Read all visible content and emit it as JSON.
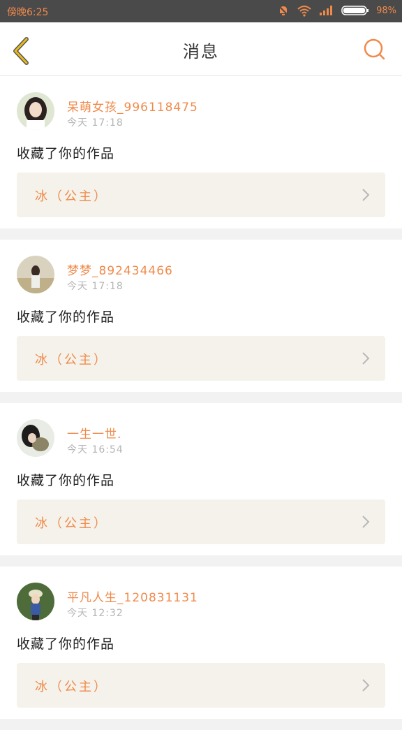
{
  "status_bar": {
    "time": "傍晚6:25",
    "battery": "98%",
    "icons": [
      "bell-off-icon",
      "wifi-icon",
      "signal-icon",
      "battery-icon"
    ]
  },
  "header": {
    "title": "消息",
    "back_icon": "chevron-left-icon",
    "search_icon": "search-icon"
  },
  "colors": {
    "accent": "#f08a4b",
    "back_arrow": "#e8b91c",
    "card_bg": "#f4f2ea"
  },
  "messages": [
    {
      "username": "呆萌女孩_996118475",
      "time": "今天  17:18",
      "action": "收藏了你的作品",
      "work_title": "冰（公主）"
    },
    {
      "username": "梦梦_892434466",
      "time": "今天  17:18",
      "action": "收藏了你的作品",
      "work_title": "冰（公主）"
    },
    {
      "username": "一生一世.",
      "time": "今天  16:54",
      "action": "收藏了你的作品",
      "work_title": "冰（公主）"
    },
    {
      "username": "平凡人生_120831131",
      "time": "今天  12:32",
      "action": "收藏了你的作品",
      "work_title": "冰（公主）"
    }
  ]
}
